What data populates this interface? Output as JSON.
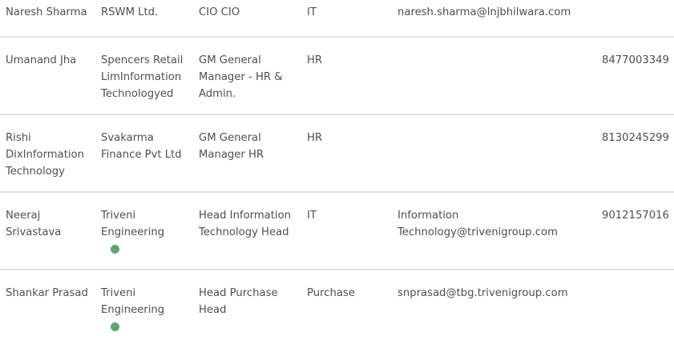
{
  "theme": {
    "dot_color": "#5aa574",
    "divider_color": "#e3e3e3"
  },
  "rows": [
    {
      "name": "Naresh Sharma",
      "company": "RSWM Ltd.",
      "title": "CIO CIO",
      "department": "IT",
      "email": "naresh.sharma@lnjbhilwara.com",
      "phone": "",
      "has_dot": false
    },
    {
      "name": "Umanand Jha",
      "company": "Spencers Retail LimInformation Technologyed",
      "title": "GM General Manager - HR & Admin.",
      "department": "HR",
      "email": "",
      "phone": "8477003349",
      "has_dot": false
    },
    {
      "name": "Rishi DixInformation Technology",
      "company": "Svakarma Finance Pvt Ltd",
      "title": "GM General Manager HR",
      "department": "HR",
      "email": "",
      "phone": "8130245299",
      "has_dot": false
    },
    {
      "name": "Neeraj Srivastava",
      "company": "Triveni Engineering",
      "title": "Head Information Technology Head",
      "department": "IT",
      "email": "Information Technology@trivenigroup.com",
      "phone": "9012157016",
      "has_dot": true
    },
    {
      "name": "Shankar Prasad",
      "company": "Triveni Engineering",
      "title": "Head Purchase Head",
      "department": "Purchase",
      "email": "snprasad@tbg.trivenigroup.com",
      "phone": "",
      "has_dot": true
    }
  ]
}
